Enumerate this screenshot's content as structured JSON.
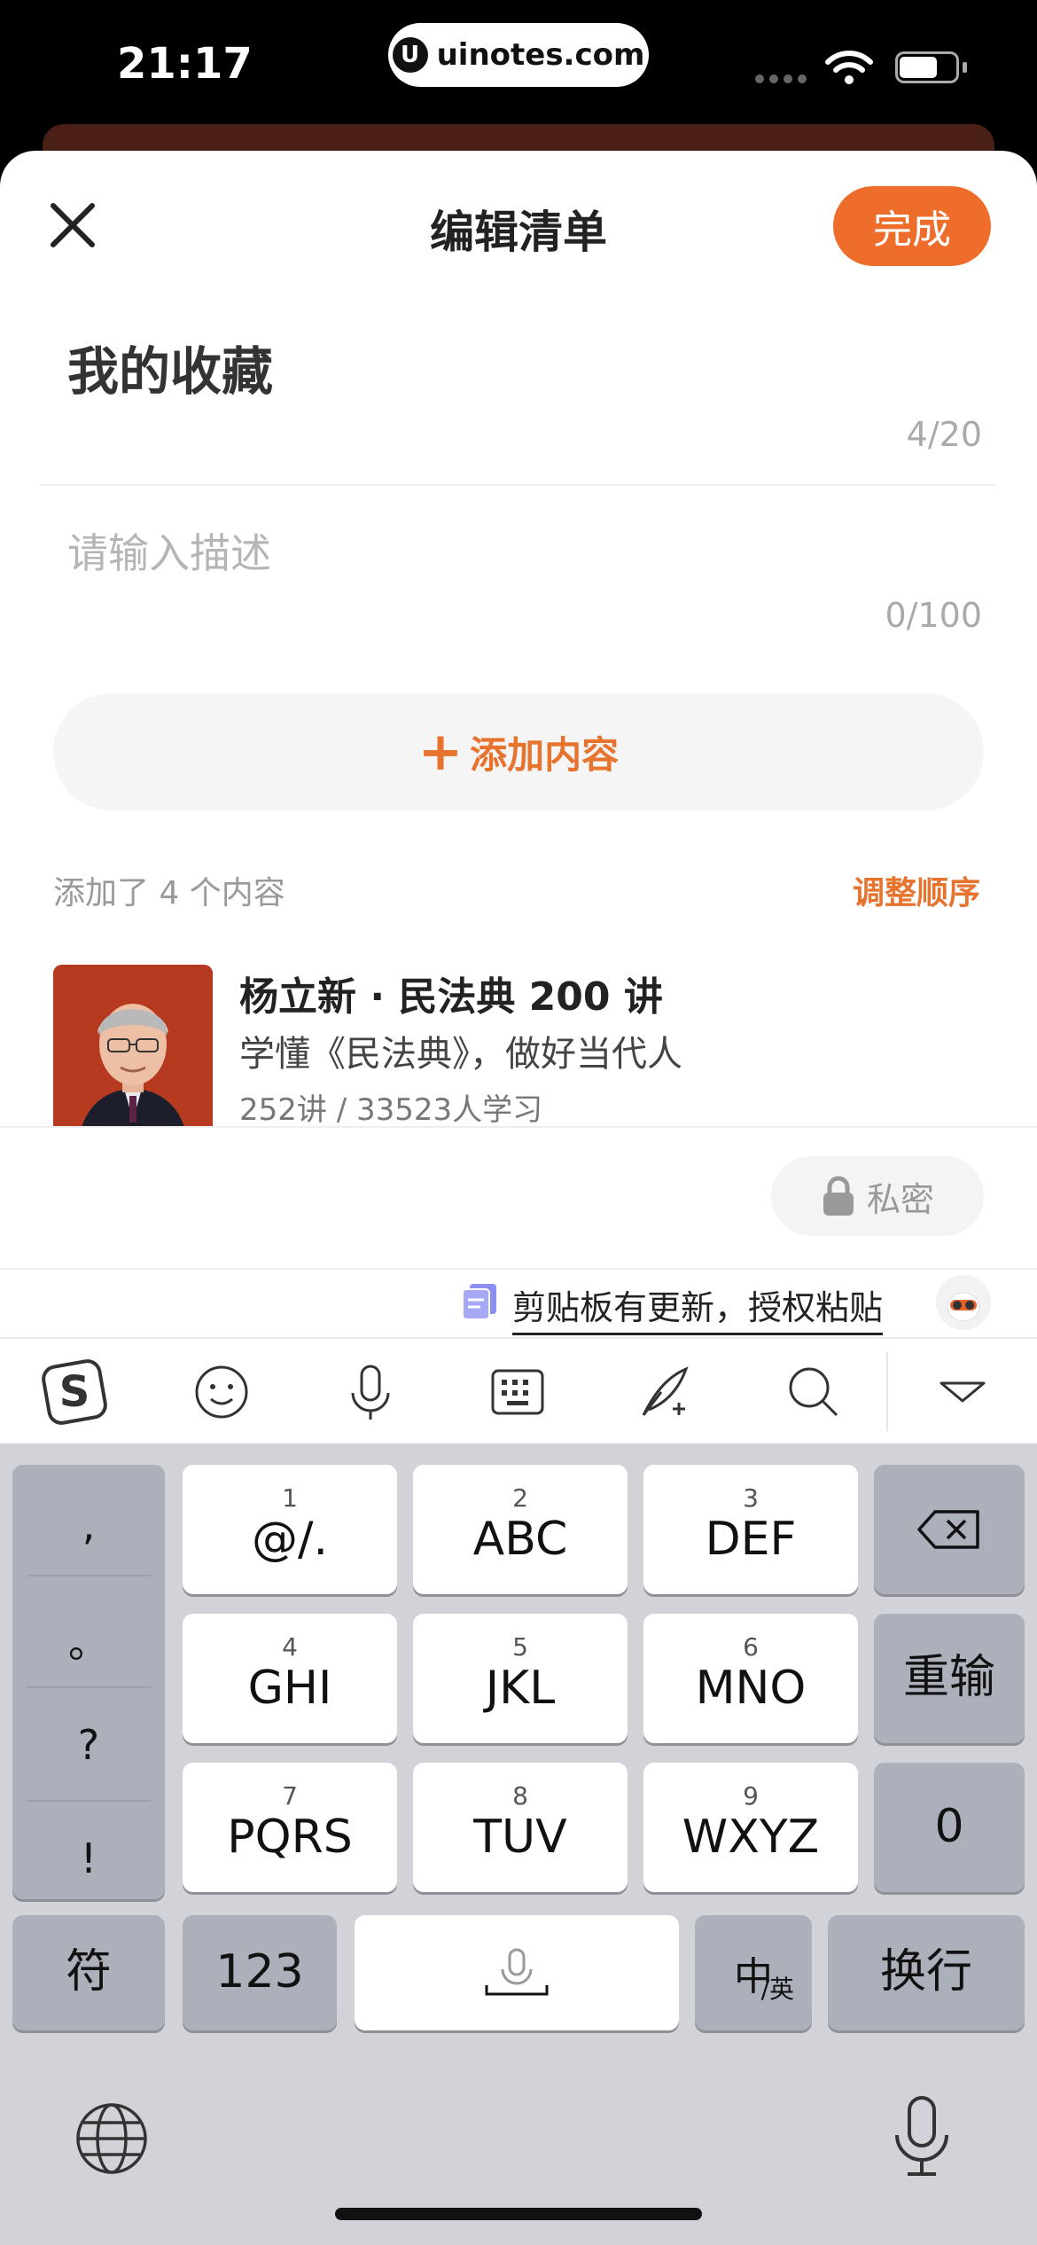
{
  "status_bar": {
    "time": "21:17",
    "url": "uinotes.com",
    "url_logo": "U"
  },
  "header": {
    "title": "编辑清单",
    "done_label": "完成",
    "close_icon": "close-icon"
  },
  "list": {
    "title": "我的收藏",
    "title_count": "4/20",
    "desc_placeholder": "请输入描述",
    "desc_count": "0/100"
  },
  "add_button": {
    "plus": "+",
    "label": "添加内容"
  },
  "content": {
    "added_count": "添加了 4 个内容",
    "reorder_label": "调整顺序",
    "items": [
      {
        "title": "杨立新 · 民法典 200 讲",
        "desc": "学懂《民法典》，做好当代人",
        "stats": "252讲 / 33523人学习"
      }
    ]
  },
  "privacy": {
    "label": "私密",
    "icon": "lock-icon"
  },
  "clipboard": {
    "text": "剪贴板有更新，授权粘贴"
  },
  "ime_toolbar": {
    "icons": [
      "sogou-logo-icon",
      "emoji-icon",
      "microphone-icon",
      "keyboard-icon",
      "handwriting-icon",
      "search-icon",
      "collapse-icon"
    ]
  },
  "keyboard": {
    "punct": [
      ",",
      "。",
      "?",
      "!"
    ],
    "rows": [
      [
        {
          "num": "1",
          "label": "@/."
        },
        {
          "num": "2",
          "label": "ABC"
        },
        {
          "num": "3",
          "label": "DEF"
        }
      ],
      [
        {
          "num": "4",
          "label": "GHI"
        },
        {
          "num": "5",
          "label": "JKL"
        },
        {
          "num": "6",
          "label": "MNO"
        }
      ],
      [
        {
          "num": "7",
          "label": "PQRS"
        },
        {
          "num": "8",
          "label": "TUV"
        },
        {
          "num": "9",
          "label": "WXYZ"
        }
      ]
    ],
    "reenter": "重输",
    "zero": "0",
    "symbols": "符",
    "numbers": "123",
    "lang_main": "中",
    "lang_sub": "/英",
    "newline": "换行"
  },
  "colors": {
    "accent": "#ee6d2a",
    "keyboard_bg": "#d1d3d9"
  }
}
